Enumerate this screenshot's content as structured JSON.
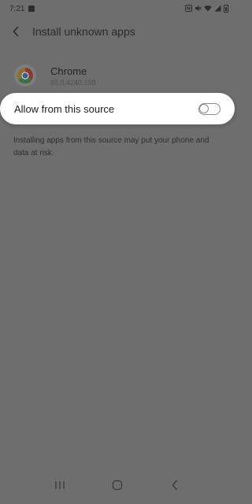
{
  "status_bar": {
    "time": "7:21",
    "icons": [
      "notification-icon",
      "nfc-icon",
      "mute-icon",
      "wifi-icon",
      "signal-icon",
      "battery-icon"
    ]
  },
  "header": {
    "title": "Install unknown apps",
    "back_icon": "back-arrow-icon"
  },
  "app": {
    "name": "Chrome",
    "version": "85.0.4240.198",
    "icon": "chrome-icon"
  },
  "setting": {
    "label": "Allow from this source",
    "enabled": false
  },
  "warning_text": "Installing apps from this source may put your phone and data at risk.",
  "nav_bar": {
    "icons": [
      "recents-icon",
      "home-icon",
      "back-icon"
    ]
  },
  "colors": {
    "overlay": "#6e6e6e",
    "card": "#ffffff",
    "chrome_red": "#db4437",
    "chrome_yellow": "#f4b400",
    "chrome_green": "#0f9d58",
    "chrome_blue": "#4285f4"
  }
}
